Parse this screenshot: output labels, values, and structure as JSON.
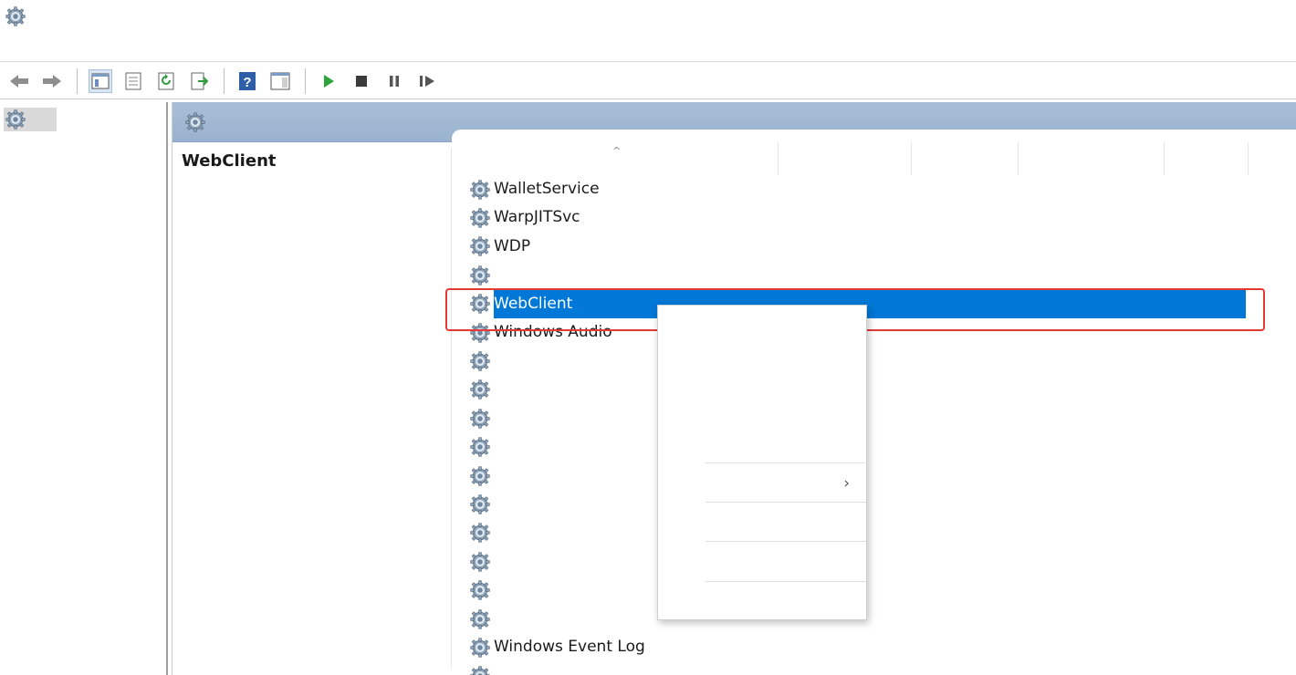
{
  "window": {
    "title": ""
  },
  "menubar": [
    {
      "label": ""
    },
    {
      "label": ""
    },
    {
      "label": ""
    },
    {
      "label": ""
    }
  ],
  "tree": {
    "root_label": ""
  },
  "panel": {
    "header": ""
  },
  "detail": {
    "service_name": "WebClient",
    "start_link": "",
    "start_suffix": "",
    "description_label": "",
    "description_lines": [
      "",
      "",
      "",
      "",
      ""
    ]
  },
  "columns": {
    "name": "",
    "description": "",
    "status": "",
    "startup_type": "",
    "logon_as": ""
  },
  "services": [
    {
      "name": "WalletService",
      "description": "",
      "status": "",
      "startup_type": "",
      "logon_as": ""
    },
    {
      "name": "WarpJITSvc",
      "description": "",
      "status": "",
      "startup_type": "",
      "logon_as": ""
    },
    {
      "name": "WDP",
      "description": "",
      "status": "",
      "startup_type": "",
      "logon_as": ""
    },
    {
      "name": "",
      "description": "",
      "status": "",
      "startup_type": "",
      "logon_as": ""
    },
    {
      "name": "WebClient",
      "description": "",
      "status": "",
      "startup_type": "",
      "logon_as": "",
      "selected": true
    },
    {
      "name": "Windows Audio",
      "description": "",
      "status": "",
      "startup_type": "",
      "logon_as": ""
    },
    {
      "name": "",
      "description": "",
      "status": "",
      "startup_type": "",
      "logon_as": ""
    },
    {
      "name": "",
      "description": "",
      "status": "",
      "startup_type": "",
      "logon_as": ""
    },
    {
      "name": "",
      "description": "",
      "status": "",
      "startup_type": "",
      "logon_as": ""
    },
    {
      "name": "",
      "description": "",
      "status": "",
      "startup_type": "",
      "logon_as": ""
    },
    {
      "name": "",
      "description": "",
      "status": "",
      "startup_type": "",
      "logon_as": ""
    },
    {
      "name": "",
      "description": "",
      "status": "",
      "startup_type": "",
      "logon_as": ""
    },
    {
      "name": "",
      "description": "",
      "status": "",
      "startup_type": "",
      "logon_as": ""
    },
    {
      "name": "",
      "description": "",
      "status": "",
      "startup_type": "",
      "logon_as": ""
    },
    {
      "name": "",
      "description": "",
      "status": "",
      "startup_type": "",
      "logon_as": ""
    },
    {
      "name": "",
      "description": "",
      "status": "",
      "startup_type": "",
      "logon_as": ""
    },
    {
      "name": "Windows Event Log",
      "description": "",
      "status": "",
      "startup_type": "",
      "logon_as": ""
    },
    {
      "name": "",
      "description": "",
      "status": "",
      "startup_type": "",
      "logon_as": ""
    }
  ],
  "context_menu": [
    {
      "label": "",
      "enabled": true
    },
    {
      "label": "",
      "enabled": false
    },
    {
      "label": "",
      "enabled": false
    },
    {
      "label": "",
      "enabled": false
    },
    {
      "label": "",
      "enabled": false
    },
    {
      "label": "",
      "enabled": true,
      "submenu": true
    },
    {
      "label": "",
      "enabled": true
    },
    {
      "label": "",
      "enabled": true,
      "bold": true
    },
    {
      "label": "",
      "enabled": true
    }
  ],
  "colors": {
    "selection": "#0078d7",
    "highlight_box": "#e53935",
    "panel_header": "#a9bfd8",
    "link": "#0066cc"
  }
}
